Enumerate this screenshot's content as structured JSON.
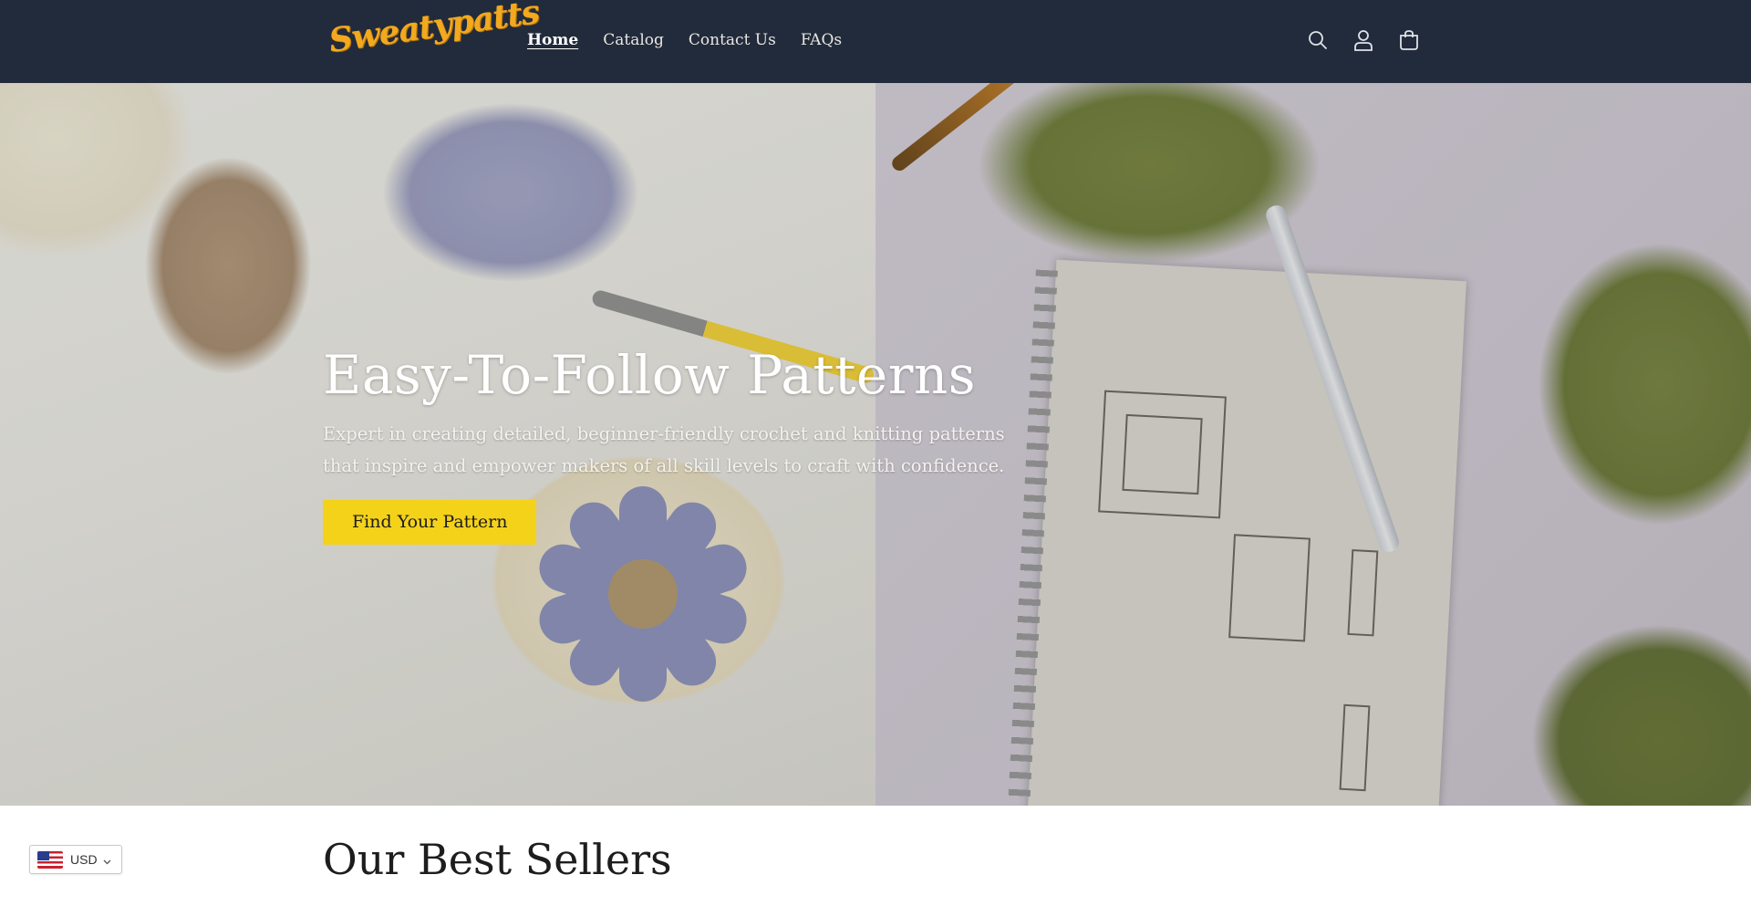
{
  "header": {
    "logo_text": "Sweatypatts",
    "nav": [
      {
        "label": "Home",
        "active": true
      },
      {
        "label": "Catalog",
        "active": false
      },
      {
        "label": "Contact Us",
        "active": false
      },
      {
        "label": "FAQs",
        "active": false
      }
    ],
    "icons": [
      "search-icon",
      "account-icon",
      "cart-icon"
    ]
  },
  "hero": {
    "title": "Easy-To-Follow Patterns",
    "description": "Expert in creating detailed, beginner-friendly crochet and knitting patterns that inspire and empower makers of all skill levels to craft with confidence.",
    "button_label": "Find Your Pattern",
    "button_color": "#f5d21a"
  },
  "best_sellers": {
    "title": "Our Best Sellers"
  },
  "currency_selector": {
    "value": "USD",
    "flag": "us-flag-icon"
  },
  "colors": {
    "header_bg": "#222b3c",
    "logo": "#f2a91e"
  }
}
